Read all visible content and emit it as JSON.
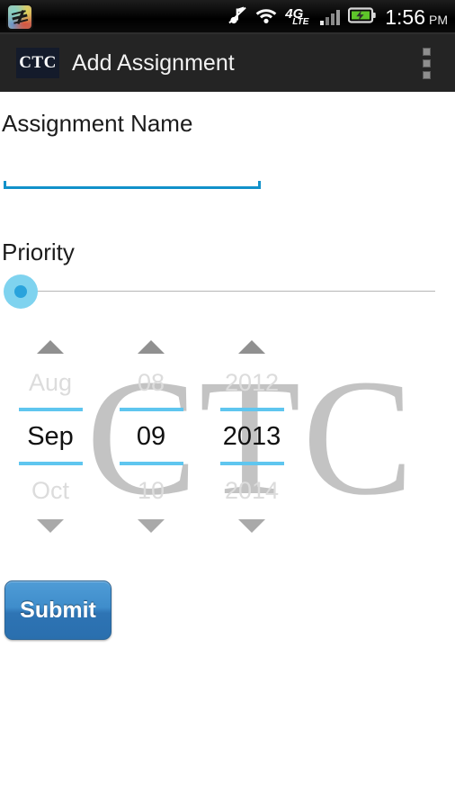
{
  "status_bar": {
    "notification_icon": "app-notification-icon",
    "icons": [
      "music-muted-icon",
      "wifi-icon",
      "4g-lte-icon",
      "signal-bars-icon",
      "battery-charging-icon"
    ],
    "network_label": "4G",
    "network_sublabel": "LTE",
    "time": "1:56",
    "ampm": "PM"
  },
  "action_bar": {
    "logo_text": "CTC",
    "title": "Add Assignment",
    "overflow_label": "More options"
  },
  "watermark": {
    "text": "CTC"
  },
  "form": {
    "assignment_name": {
      "label": "Assignment Name",
      "value": "",
      "placeholder": ""
    },
    "priority": {
      "label": "Priority",
      "value": 0,
      "min": 0,
      "max": 100,
      "track_color": "#b6b6b6",
      "thumb_color": "#7fd3ef",
      "thumb_core_color": "#29a3dc"
    },
    "date_picker": {
      "columns": [
        {
          "name": "month",
          "previous": "Aug",
          "current": "Sep",
          "next": "Oct"
        },
        {
          "name": "day",
          "previous": "08",
          "current": "09",
          "next": "10"
        },
        {
          "name": "year",
          "previous": "2012",
          "current": "2013",
          "next": "2014"
        }
      ],
      "divider_color": "#5fc6ef",
      "increment_label": "Increment",
      "decrement_label": "Decrement"
    },
    "submit": {
      "label": "Submit",
      "color": "#3f8dcb"
    }
  }
}
